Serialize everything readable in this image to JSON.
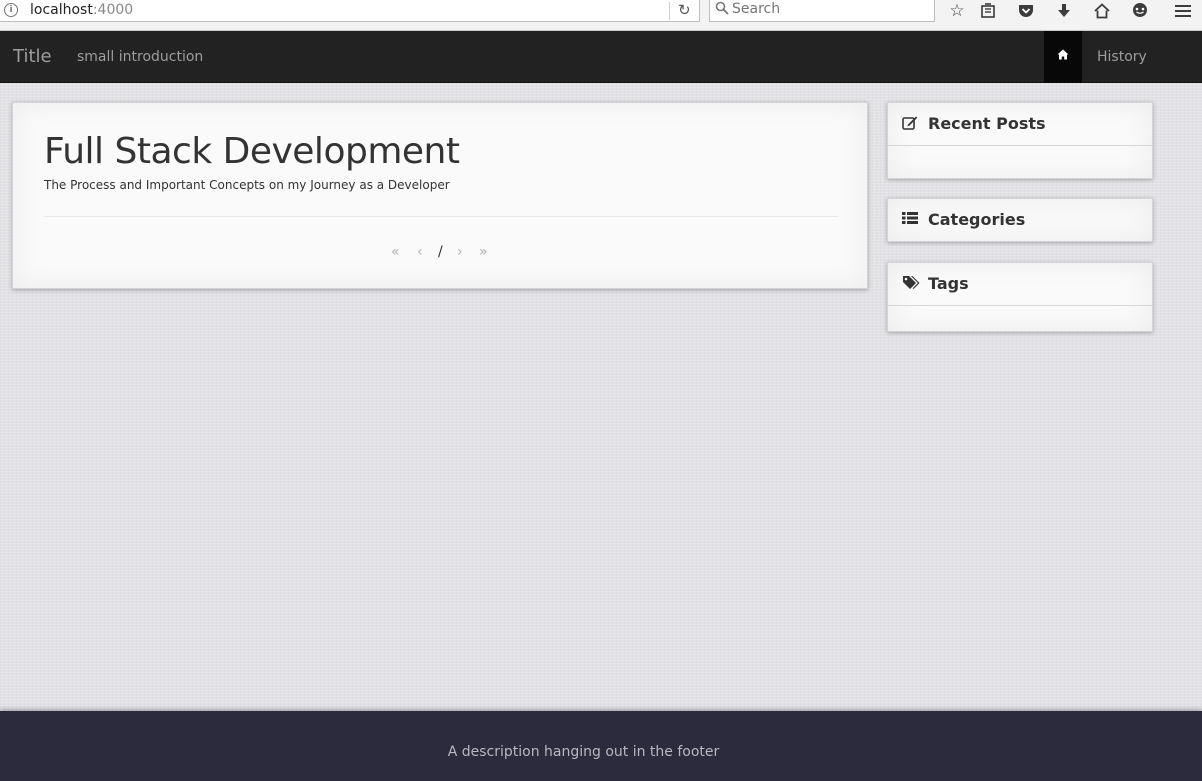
{
  "browser": {
    "url_host": "localhost",
    "url_port": ":4000",
    "search_placeholder": "Search",
    "icons": [
      "info-icon",
      "reload-icon",
      "search-icon",
      "bookmark-star-icon",
      "reading-list-icon",
      "pocket-icon",
      "download-icon",
      "home-icon",
      "chat-icon",
      "menu-icon"
    ]
  },
  "navbar": {
    "brand": "Title",
    "intro": "small introduction",
    "home_icon": "home-icon",
    "history": "History",
    "colors": {
      "bar": "#222222",
      "active": "#080808",
      "link": "#9d9d9d"
    }
  },
  "main": {
    "title": "Full Stack Development",
    "subtitle": "The Process and Important Concepts on my Journey as a Developer",
    "pager": {
      "first": "«",
      "prev": "‹",
      "current": "/",
      "next": "›",
      "last": "»"
    }
  },
  "sidebar": {
    "recent_posts": {
      "label": "Recent Posts",
      "icon": "edit-icon"
    },
    "categories": {
      "label": "Categories",
      "icon": "list-icon"
    },
    "tags": {
      "label": "Tags",
      "icon": "tags-icon"
    }
  },
  "footer": {
    "text": "A description hanging out in the footer",
    "color": "#2b2b3d"
  }
}
